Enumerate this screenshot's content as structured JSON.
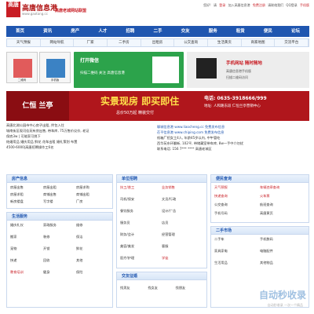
{
  "header": {
    "logo_mark": "高唐",
    "logo_title": "高唐信息港",
    "logo_domain": "www.gaotang.cc",
    "slogan": "高唐老城网站联盟",
    "top_links": [
      "您好!",
      "请",
      "登录",
      "加入高唐信息港",
      "免费注册",
      "请联络我们",
      "QQ登录",
      "手机版"
    ]
  },
  "nav": [
    "首页",
    "资讯",
    "房产",
    "人才",
    "招聘",
    "二手",
    "交友",
    "服务",
    "租赁",
    "便民",
    "论坛",
    ""
  ],
  "subnav": [
    "天气预报",
    "网站导航",
    "厂家",
    "二手房",
    "出租房",
    "公交查询",
    "生活黄页",
    "商家地图",
    "交流平台"
  ],
  "thumbs": [
    {
      "caption": "二维码"
    },
    {
      "caption": "手机版"
    }
  ],
  "wechat_banner": {
    "title": "打开微信",
    "desc": "扫描二维码 关注 高唐信息港"
  },
  "right_ad": {
    "title": "手机网站 随时随地",
    "line1": "高唐信息港手机版",
    "line2": "扫描二维码访问"
  },
  "red_banner": {
    "brand": "仁恒 兰亭",
    "headline": "实景现房 即买即住",
    "sub": "总价50万起 精装交付",
    "tel": "电话: 0635-3918666/999",
    "addr": "地址: 人和路东段 仁恒兰亭营销中心"
  },
  "news_left": [
    "高唐北湖公园市中心房子出租, 拎包入住",
    "城南街区观河佳苑有房出售, 带车库, 75万售价议价, 老证",
    "保底3w | 可能家可挑下",
    "结婚用品 婚庆用品 鲜花 花车出租 婚礼策划 布置",
    "4500-6000|高唐招聘操作工6名"
  ],
  "news_right": [
    "聊城信息港 www.liaocheng.cc 免费发布信息",
    "茌平信息港 www.chiping.com 免费发布信息",
    "纸箱厂招女工4人, 年龄45岁以内, 中午管吃",
    "西华苑东环翻新, 102平, 带储藏室带车库, 8w一手中介勿扰",
    "联系电话: 156 7*** **** 高唐老城区"
  ],
  "panels": {
    "house": {
      "title": "房产信息",
      "items": [
        "房屋出售",
        "房屋出租",
        "房屋求购",
        "房屋求租",
        "商铺出售",
        "商铺出租",
        "新房楼盘",
        "写字楼",
        "厂房"
      ]
    },
    "life": {
      "title": "生活服务",
      "items": [
        "婚庆礼仪",
        "家政服务",
        "维修",
        "搬家",
        "装修",
        "保洁",
        "宠物",
        "开锁",
        "鲜花",
        "快递",
        "回收",
        "其他",
        "教育培训",
        "健身",
        "保险"
      ]
    },
    "jobs": {
      "title": "单位招聘",
      "items": [
        "技工/普工",
        "业务销售",
        "司机/保安",
        "文员/行政",
        "餐饮服务",
        "设计/广告",
        "服务员",
        "店员",
        "财务/会计",
        "经营管理",
        "美容/美发",
        "客服",
        "医疗/护理",
        "学徒",
        "其他"
      ]
    },
    "friends": {
      "title": "交友征婚",
      "items": [
        "找男友",
        "找女友",
        "找朋友"
      ]
    },
    "convenience": {
      "title": "便民查询",
      "items": [
        "天气预报",
        "车辆违章查询",
        "快递查询",
        "火车票",
        "公交查询",
        "航班查询",
        "手机号码",
        "高唐黄页"
      ]
    },
    "secondhand": {
      "title": "二手市场",
      "items": [
        "二手车",
        "手机数码",
        "家具家电",
        "电脑配件",
        "生活用品",
        "其他物品"
      ]
    }
  },
  "watermark": {
    "main": "自动秒收录",
    "sub": "自动秒收录 一次一个精品"
  }
}
